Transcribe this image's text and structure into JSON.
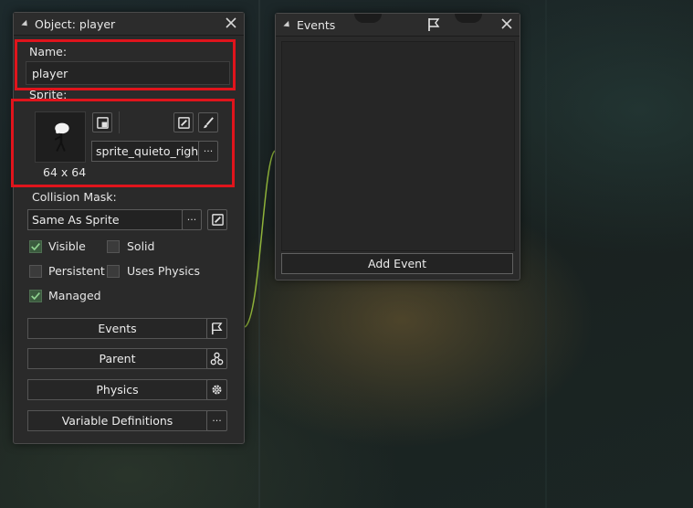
{
  "object_panel": {
    "title": "Object: player",
    "name_label": "Name:",
    "name_value": "player",
    "sprite_label": "Sprite:",
    "sprite_size": "64 x 64",
    "sprite_name": "sprite_quieto_right",
    "browse_label": "···",
    "collision_label": "Collision Mask:",
    "collision_value": "Same As Sprite",
    "checkboxes": {
      "visible": {
        "label": "Visible",
        "checked": true
      },
      "solid": {
        "label": "Solid",
        "checked": false
      },
      "persistent": {
        "label": "Persistent",
        "checked": false
      },
      "uses_physics": {
        "label": "Uses Physics",
        "checked": false
      },
      "managed": {
        "label": "Managed",
        "checked": true
      }
    },
    "buttons": {
      "events": "Events",
      "parent": "Parent",
      "physics": "Physics",
      "variable_definitions": "Variable Definitions"
    }
  },
  "events_panel": {
    "title": "Events",
    "add_event": "Add Event"
  },
  "colors": {
    "highlight": "#e0141c",
    "link_line": "#8fb33a",
    "checkbox_checked": "#3a5a3d"
  }
}
